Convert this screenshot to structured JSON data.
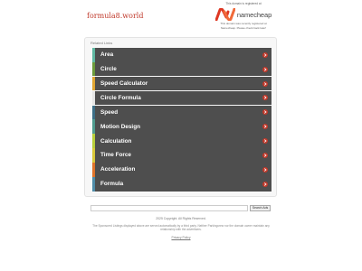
{
  "header": {
    "site_name": "formula8.world"
  },
  "registrar": {
    "note": "This domain is registered at",
    "brand": "namecheap",
    "subnote_line1": "This domain was recently registered at",
    "subnote_line2": "Namecheap. Please check back later!",
    "logo_color": "#de3723"
  },
  "panel": {
    "title": "Related Links",
    "links": [
      {
        "label": "Area",
        "accent": "#5fb8a2"
      },
      {
        "label": "Circle",
        "accent": "#6c9b3c"
      },
      {
        "label": "Speed Calculator",
        "accent": "#e0a632"
      },
      {
        "label": "Circle Formula",
        "accent": "#e6e6e6"
      },
      {
        "label": "Speed",
        "accent": "#3d6f87"
      },
      {
        "label": "Motion Design",
        "accent": "#4f9b8e"
      },
      {
        "label": "Calculation",
        "accent": "#b8cf3a"
      },
      {
        "label": "Time Force",
        "accent": "#d9c93a"
      },
      {
        "label": "Acceleration",
        "accent": "#e0742a"
      },
      {
        "label": "Formula",
        "accent": "#4e8ca8"
      }
    ]
  },
  "search": {
    "value": "",
    "button_label": "Search Ads"
  },
  "footer": {
    "copyright": "2025 Copyright. All Rights Reserved.",
    "disclaimer_line1": "The Sponsored Listings displayed above are served automatically by a third party. Neither Parkingcrew nor the domain owner maintain any",
    "disclaimer_line2": "relationship with the advertisers.",
    "privacy": "Privacy Policy"
  },
  "colors": {
    "link_bg": "#4e4e4e",
    "arrow": "#c0392b",
    "site_name": "#c0392b"
  }
}
